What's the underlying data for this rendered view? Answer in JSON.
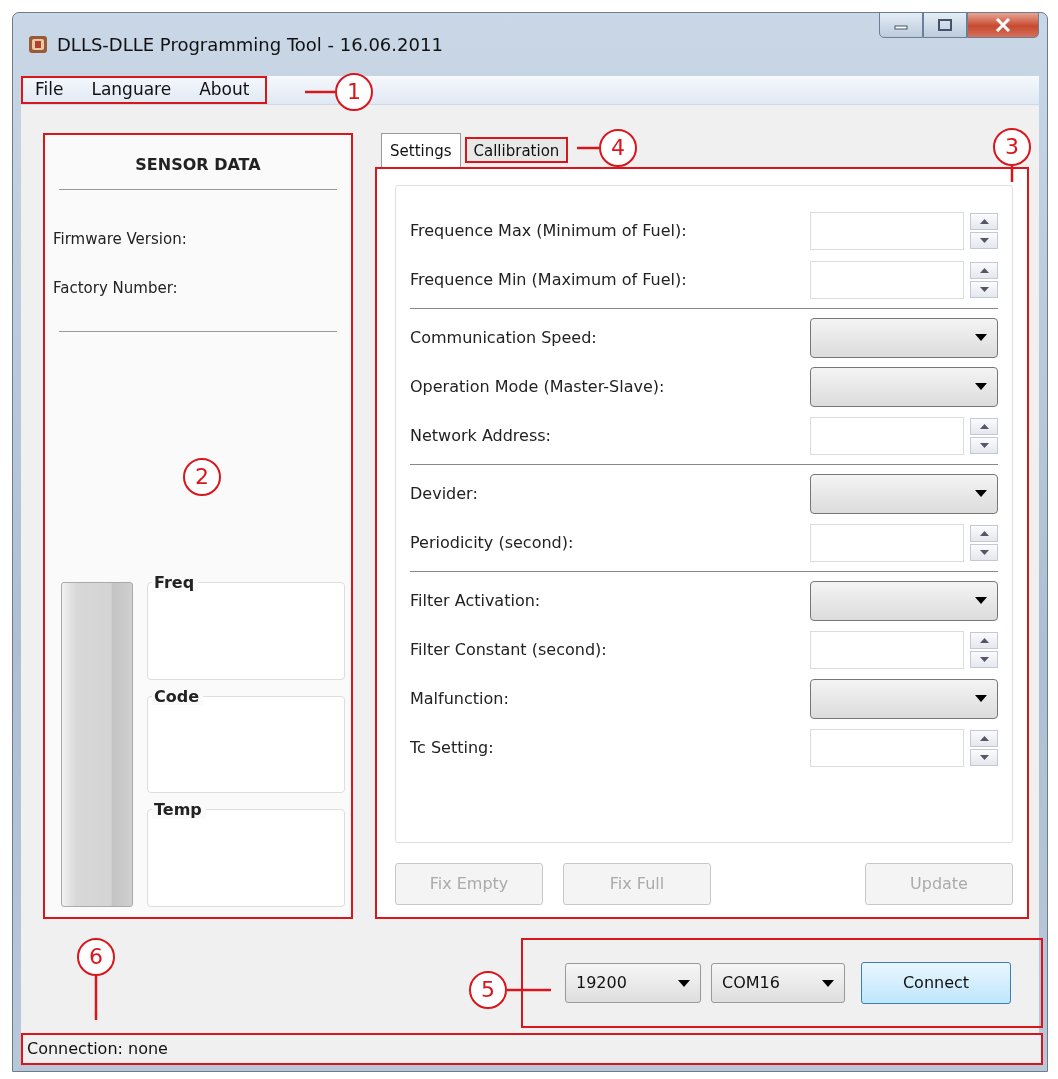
{
  "window": {
    "title": "DLLS-DLLE Programming Tool - 16.06.2011"
  },
  "menu_bar": {
    "items": [
      "File",
      "Languare",
      "About"
    ],
    "callout": "1"
  },
  "sensor_panel": {
    "title": "SENSOR DATA",
    "fields": [
      "Firmware Version:",
      "Factory Number:"
    ],
    "callout": "2",
    "groups": [
      "Freq",
      "Code",
      "Temp"
    ]
  },
  "tabs": [
    {
      "label": "Settings",
      "selected": true
    },
    {
      "label": "Callibration",
      "selected": false,
      "callout": "4"
    }
  ],
  "settings_panel": {
    "callout": "3",
    "sections": [
      [
        {
          "label": "Frequence Max (Minimum of Fuel):",
          "kind": "spin"
        },
        {
          "label": "Frequence Min (Maximum of Fuel):",
          "kind": "spin"
        }
      ],
      [
        {
          "label": "Communication Speed:",
          "kind": "combo"
        },
        {
          "label": "Operation Mode (Master-Slave):",
          "kind": "combo"
        },
        {
          "label": "Network Address:",
          "kind": "spin"
        }
      ],
      [
        {
          "label": "Devider:",
          "kind": "combo"
        },
        {
          "label": "Periodicity (second):",
          "kind": "spin"
        }
      ],
      [
        {
          "label": "Filter Activation:",
          "kind": "combo"
        },
        {
          "label": "Filter Constant (second):",
          "kind": "spin"
        },
        {
          "label": "Malfunction:",
          "kind": "combo"
        },
        {
          "label": "Tc Setting:",
          "kind": "spin"
        }
      ]
    ],
    "buttons": [
      {
        "label": "Fix Empty",
        "disabled": true
      },
      {
        "label": "Fix Full",
        "disabled": true
      },
      {
        "label": "Update",
        "disabled": true
      }
    ]
  },
  "connection": {
    "callout": "5",
    "baud_rate": "19200",
    "port": "COM16",
    "button": {
      "label": "Connect",
      "disabled": false
    }
  },
  "status_bar": {
    "text": "Connection: none",
    "callout": "6"
  }
}
